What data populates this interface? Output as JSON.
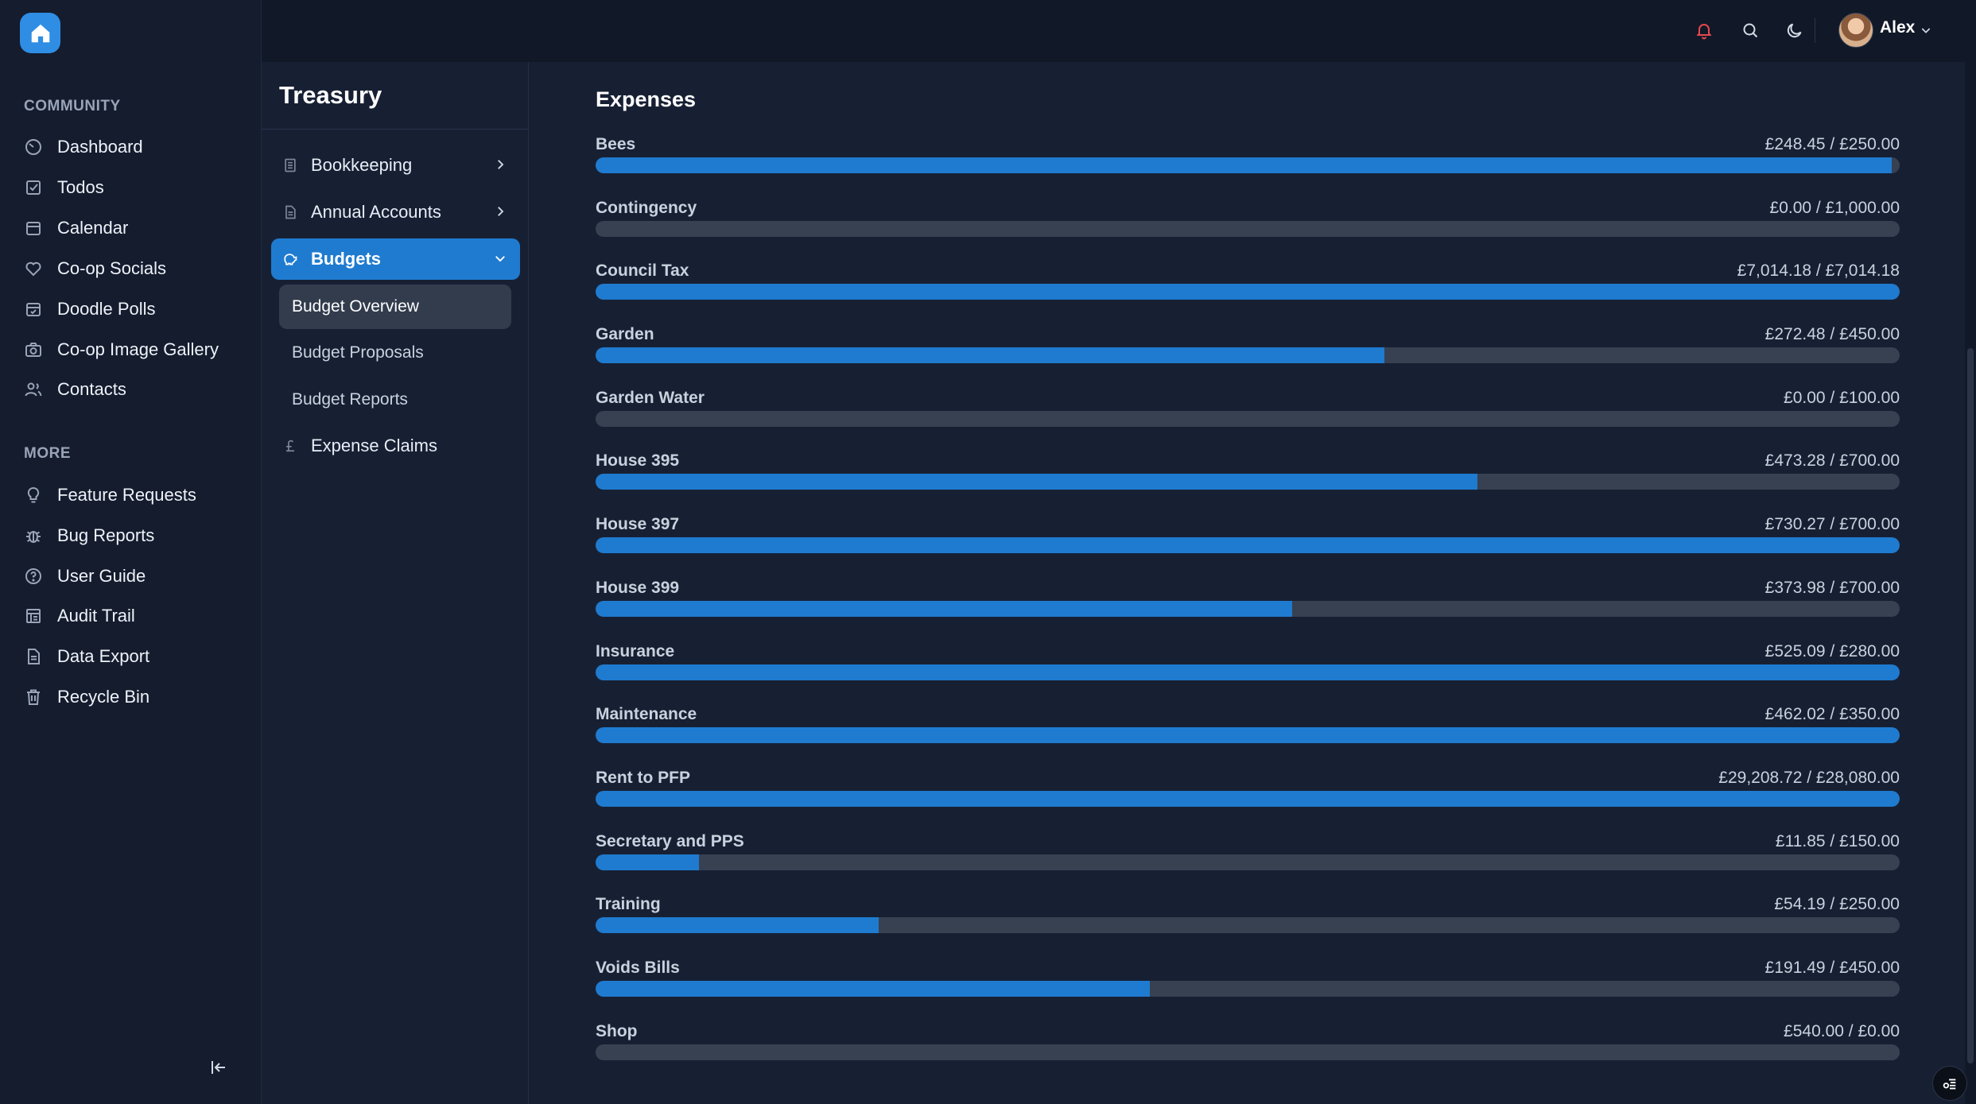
{
  "sidebar": {
    "community_label": "COMMUNITY",
    "community_items": [
      {
        "label": "Dashboard",
        "icon": "dashboard-icon"
      },
      {
        "label": "Todos",
        "icon": "checkbox-icon"
      },
      {
        "label": "Calendar",
        "icon": "calendar-icon"
      },
      {
        "label": "Co-op Socials",
        "icon": "heart-icon"
      },
      {
        "label": "Doodle Polls",
        "icon": "calendar-check-icon"
      },
      {
        "label": "Co-op Image Gallery",
        "icon": "camera-icon"
      },
      {
        "label": "Contacts",
        "icon": "users-icon"
      }
    ],
    "more_label": "MORE",
    "more_items": [
      {
        "label": "Feature Requests",
        "icon": "lightbulb-icon"
      },
      {
        "label": "Bug Reports",
        "icon": "bug-icon"
      },
      {
        "label": "User Guide",
        "icon": "help-circle-icon"
      },
      {
        "label": "Audit Trail",
        "icon": "audit-icon"
      },
      {
        "label": "Data Export",
        "icon": "file-icon"
      },
      {
        "label": "Recycle Bin",
        "icon": "trash-icon"
      }
    ]
  },
  "topbar": {
    "user_name": "Alex"
  },
  "treasury": {
    "title": "Treasury",
    "items": [
      {
        "label": "Bookkeeping"
      },
      {
        "label": "Annual Accounts"
      },
      {
        "label": "Budgets"
      },
      {
        "label": "Expense Claims"
      }
    ],
    "budget_children": [
      {
        "label": "Budget Overview"
      },
      {
        "label": "Budget Proposals"
      },
      {
        "label": "Budget Reports"
      }
    ]
  },
  "main": {
    "title": "Expenses",
    "budgets": [
      {
        "label": "Bees",
        "value": "£248.45 / £250.00",
        "progress": 0.994
      },
      {
        "label": "Contingency",
        "value": "£0.00 / £1,000.00",
        "progress": 0
      },
      {
        "label": "Council Tax",
        "value": "£7,014.18 / £7,014.18",
        "progress": 1
      },
      {
        "label": "Garden",
        "value": "£272.48 / £450.00",
        "progress": 0.605
      },
      {
        "label": "Garden Water",
        "value": "£0.00 / £100.00",
        "progress": 0
      },
      {
        "label": "House 395",
        "value": "£473.28 / £700.00",
        "progress": 0.676
      },
      {
        "label": "House 397",
        "value": "£730.27 / £700.00",
        "progress": 1
      },
      {
        "label": "House 399",
        "value": "£373.98 / £700.00",
        "progress": 0.534
      },
      {
        "label": "Insurance",
        "value": "£525.09 / £280.00",
        "progress": 1
      },
      {
        "label": "Maintenance",
        "value": "£462.02 / £350.00",
        "progress": 1
      },
      {
        "label": "Rent to PFP",
        "value": "£29,208.72 / £28,080.00",
        "progress": 1
      },
      {
        "label": "Secretary and PPS",
        "value": "£11.85 / £150.00",
        "progress": 0.079
      },
      {
        "label": "Training",
        "value": "£54.19 / £250.00",
        "progress": 0.217
      },
      {
        "label": "Voids Bills",
        "value": "£191.49 / £450.00",
        "progress": 0.425
      },
      {
        "label": "Shop",
        "value": "£540.00 / £0.00",
        "progress": 0
      }
    ]
  },
  "colors": {
    "accent": "#1f7bd0",
    "background": "#141c2e",
    "panel": "#172033",
    "track": "#374151",
    "alert": "#e5484d"
  }
}
